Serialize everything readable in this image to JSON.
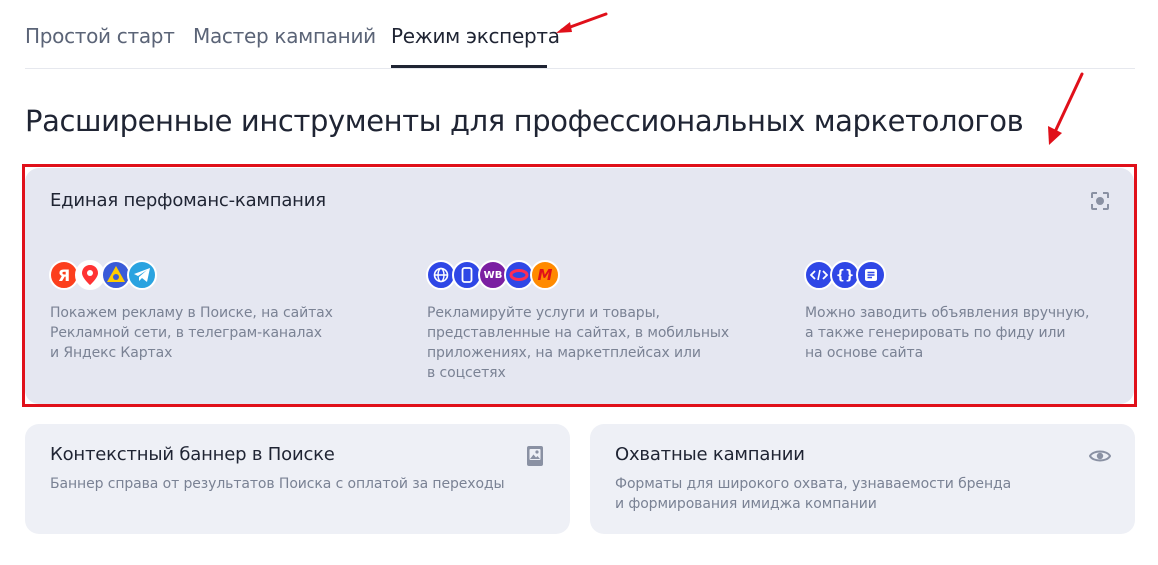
{
  "tabs": [
    {
      "label": "Простой старт"
    },
    {
      "label": "Мастер кампаний"
    },
    {
      "label": "Режим эксперта"
    }
  ],
  "headline": "Расширенные инструменты для профессиональных маркетологов",
  "perf_card": {
    "title": "Единая перфоманс-кампания",
    "corner_icon": "focus-icon",
    "columns": [
      {
        "icons": [
          "yandex-icon",
          "maps-pin-icon",
          "games-icon",
          "telegram-icon"
        ],
        "text": "Покажем рекламу в Поиске, на сайтах\nРекламной сети, в телеграм-каналах\nи Яндекс Картах"
      },
      {
        "icons": [
          "globe-icon",
          "mobile-icon",
          "wildberries-icon",
          "ozon-icon",
          "megamarket-icon"
        ],
        "ic_labels": {
          "wb": "WB",
          "mm": "M"
        },
        "text": "Рекламируйте услуги и товары,\nпредставленные на сайтах, в мобильных\nприложениях, на маркетплейсах или\nв соцсетях"
      },
      {
        "icons": [
          "code-icon",
          "braces-icon",
          "document-icon"
        ],
        "ic_labels": {
          "braces": "{}"
        },
        "text": "Можно заводить объявления вручную,\nа также генерировать по фиду или\nна основе сайта"
      }
    ]
  },
  "banner_card": {
    "title": "Контекстный баннер в Поиске",
    "desc": "Баннер справа от результатов Поиска с оплатой за переходы",
    "corner_icon": "image-icon"
  },
  "reach_card": {
    "title": "Охватные кампании",
    "desc": "Форматы для широкого охвата, узнаваемости бренда\nи формирования имиджа компании",
    "corner_icon": "eye-icon"
  },
  "colors": {
    "text": "#1f2433",
    "muted": "#7a8294",
    "card_bg": "#eef0f6",
    "highlight": "#e0101a",
    "accent_blue": "#2f47e6"
  }
}
